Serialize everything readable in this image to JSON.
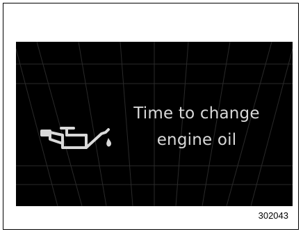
{
  "display": {
    "message_line1": "Time to change",
    "message_line2": "engine oil",
    "icon": "oil-can-icon",
    "colors": {
      "background": "#000000",
      "text": "#d9d9d9",
      "icon": "#d9d9d9",
      "grid": "#2a2a2a"
    }
  },
  "figure_id": "302043"
}
